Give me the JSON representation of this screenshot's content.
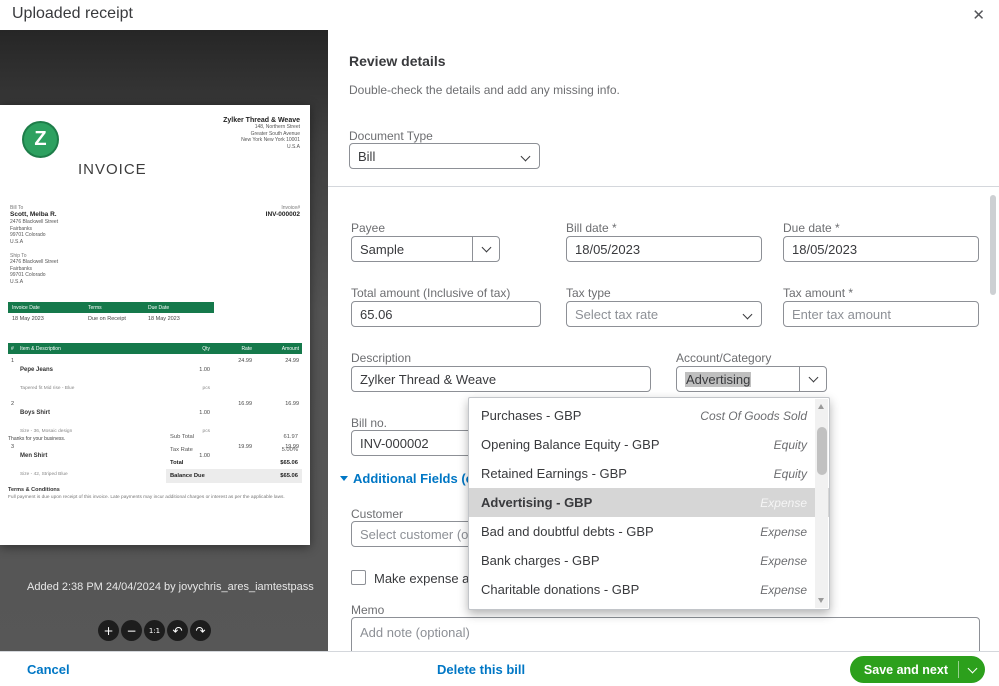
{
  "modal": {
    "title": "Uploaded receipt"
  },
  "preview": {
    "added_text": "Added 2:38 PM 24/04/2024 by jovychris_ares_iamtestpass",
    "controls": {
      "zoom_in": "+",
      "zoom_out": "−",
      "actual_size": "1:1",
      "rotate_left": "↶",
      "rotate_right": "↷"
    },
    "invoice": {
      "logo_letter": "Z",
      "title": "INVOICE",
      "company": {
        "name": "Zylker Thread & Weave",
        "address": [
          "148, Northern Street",
          "Greater South Avenue",
          "New York New York 10001",
          "U.S.A"
        ]
      },
      "bill_to": {
        "label": "Bill To",
        "name": "Scott, Melba R.",
        "lines": [
          "2476 Blackwell Street",
          "Fairbanks",
          "99701 Colorado",
          "U.S.A"
        ]
      },
      "ship_to": {
        "label": "Ship To",
        "lines": [
          "2476 Blackwell Street",
          "Fairbanks",
          "99701 Colorado",
          "U.S.A"
        ]
      },
      "invoice_no": {
        "label": "Invoice#",
        "value": "INV-000002"
      },
      "meta": {
        "headers": [
          "Invoice Date",
          "Terms",
          "Due Date"
        ],
        "values": [
          "18 May 2023",
          "Due on Receipt",
          "18 May 2023"
        ]
      },
      "items_table": {
        "headers": [
          "#",
          "Item & Description",
          "Qty",
          "Rate",
          "Amount"
        ],
        "rows": [
          {
            "no": "1",
            "name": "Pepe Jeans",
            "desc": "Tapered fit Mid rise - Blue",
            "qty": "1.00",
            "unit": "pcs",
            "rate": "24.99",
            "amount": "24.99"
          },
          {
            "no": "2",
            "name": "Boys Shirt",
            "desc": "Size - 36, Mosaic design",
            "qty": "1.00",
            "unit": "pcs",
            "rate": "16.99",
            "amount": "16.99"
          },
          {
            "no": "3",
            "name": "Men Shirt",
            "desc": "Size - 42, Striped Blue",
            "qty": "1.00",
            "unit": "pcs",
            "rate": "19.99",
            "amount": "19.99"
          }
        ]
      },
      "totals": {
        "rows": [
          {
            "label": "Sub Total",
            "value": "61.97"
          },
          {
            "label": "Tax Rate",
            "value": "5.00%"
          },
          {
            "label": "Total",
            "value": "$65.06"
          },
          {
            "label": "Balance Due",
            "value": "$65.06"
          }
        ]
      },
      "thanks": "Thanks for your business.",
      "terms": {
        "label": "Terms & Conditions",
        "text": "Full payment is due upon receipt of this invoice. Late payments may incur additional charges or interest as per the applicable laws."
      }
    }
  },
  "form": {
    "heading": "Review details",
    "subheading": "Double-check the details and add any missing info.",
    "document_type": {
      "label": "Document Type",
      "value": "Bill"
    },
    "payee": {
      "label": "Payee",
      "value": "Sample"
    },
    "bill_date": {
      "label": "Bill date *",
      "value": "18/05/2023"
    },
    "due_date": {
      "label": "Due date *",
      "value": "18/05/2023"
    },
    "total_amount": {
      "label": "Total amount (Inclusive of tax)",
      "value": "65.06"
    },
    "tax_type": {
      "label": "Tax type",
      "placeholder": "Select tax rate"
    },
    "tax_amount": {
      "label": "Tax amount *",
      "placeholder": "Enter tax amount"
    },
    "description": {
      "label": "Description",
      "value": "Zylker Thread & Weave"
    },
    "account_category": {
      "label": "Account/Category",
      "value": "Advertising"
    },
    "bill_no": {
      "label": "Bill no.",
      "value": "INV-000002"
    },
    "additional_fields_link": "Additional Fields (optional)",
    "customer": {
      "label": "Customer",
      "placeholder": "Select customer (opti"
    },
    "billable_checkbox_label": "Make expense and ite",
    "memo": {
      "label": "Memo",
      "placeholder": "Add note (optional)"
    }
  },
  "dropdown": {
    "items": [
      {
        "name": "Purchases  - GBP",
        "type": "Cost Of Goods Sold"
      },
      {
        "name": "Opening Balance Equity  - GBP",
        "type": "Equity"
      },
      {
        "name": "Retained Earnings  - GBP",
        "type": "Equity"
      },
      {
        "name": "Advertising  - GBP",
        "type": "Expense"
      },
      {
        "name": "Bad and doubtful debts  - GBP",
        "type": "Expense"
      },
      {
        "name": "Bank charges  - GBP",
        "type": "Expense"
      },
      {
        "name": "Charitable donations  - GBP",
        "type": "Expense"
      }
    ]
  },
  "footer": {
    "cancel": "Cancel",
    "delete": "Delete this bill",
    "save": "Save and next"
  },
  "colors": {
    "accent_green": "#2ca01c",
    "link_blue": "#0077c5",
    "invoice_green": "#15794b"
  }
}
